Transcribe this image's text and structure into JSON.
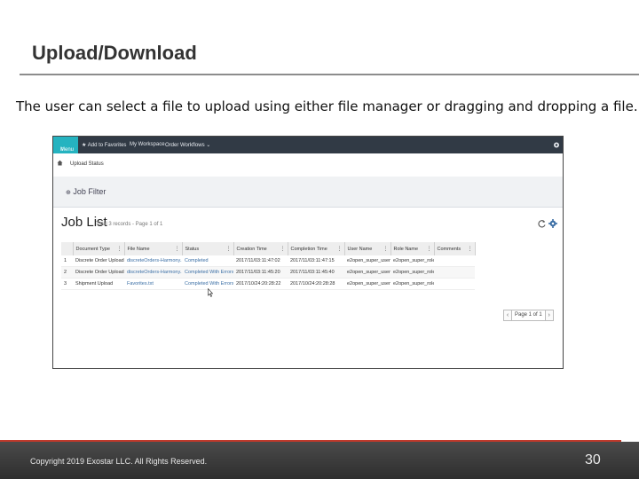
{
  "slide": {
    "title": "Upload/Download",
    "subtitle": "The user can select a file to upload using either file manager or dragging and dropping a file.",
    "copyright": "Copyright 2019 Exostar LLC. All Rights Reserved.",
    "page_number": "30"
  },
  "app": {
    "topbar": {
      "menu_label": "Menu",
      "add_favorites_label": "Add to Favorites",
      "workspace_label": "My Workspace",
      "order_workflows_label": "Order Workflows"
    },
    "breadcrumb": {
      "label": "Upload Status"
    },
    "filter": {
      "label": "Job Filter"
    },
    "job_list": {
      "title": "Job List",
      "summary": "Total 3 records - Page 1 of 1",
      "columns": [
        "",
        "Document Type",
        "File Name",
        "Status",
        "Creation Time",
        "Completion Time",
        "User Name",
        "Role Name",
        "Comments"
      ],
      "rows": [
        [
          "1",
          "Discrete Order Upload",
          "discreteOrders-Harmony...",
          "Completed",
          "2017/11/03:11:47:02",
          "2017/11/03:11:47:15",
          "e2open_super_user",
          "e2open_super_role",
          ""
        ],
        [
          "2",
          "Discrete Order Upload",
          "discreteOrders-Harmony...",
          "Completed With Errors",
          "2017/11/03:11:45:20",
          "2017/11/03:11:45:40",
          "e2open_super_user",
          "e2open_super_role",
          ""
        ],
        [
          "3",
          "Shipment Upload",
          "Favorites.txt",
          "Completed With Errors",
          "2017/10/24:20:28:22",
          "2017/10/24:20:28:28",
          "e2open_super_user",
          "e2open_super_role",
          ""
        ]
      ],
      "link_columns": [
        2,
        3
      ],
      "flagged_cells": [
        [
          1,
          3
        ],
        [
          2,
          3
        ]
      ]
    },
    "pager": {
      "label": "Page 1 of 1"
    },
    "colors": {
      "topbar": "#313a45",
      "menu_accent": "#25b3c0",
      "link": "#3a6ea5",
      "footer_rule": "#c0392b"
    }
  }
}
